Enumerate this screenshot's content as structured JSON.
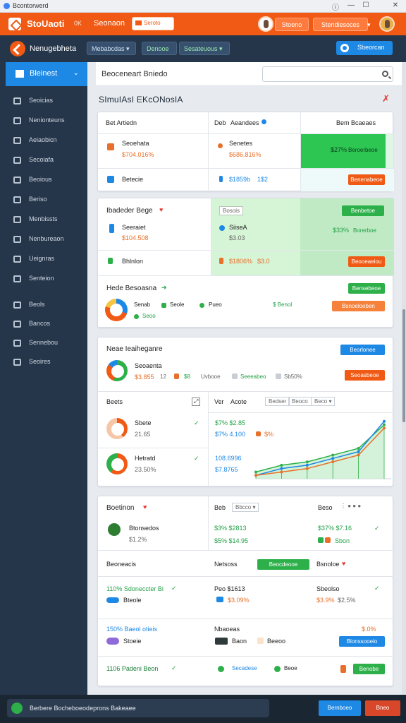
{
  "window": {
    "title": "Bcontorwerd",
    "controls": [
      "ⓘ",
      "—",
      "☐",
      "✕"
    ]
  },
  "topbar": {
    "brand": "StoUaoti",
    "hint": "0K",
    "text": "Seonaon",
    "input": "Seroto",
    "btn1": "Stoeno",
    "btn2": "Stendiesoces"
  },
  "navbar": {
    "title": "Nenugebheta",
    "select1": "Mebabcdas",
    "select2": "Denooe",
    "select3": "Sesateuous",
    "button": "Sbeorcan"
  },
  "sidebar": {
    "active": "Bleinest",
    "items": [
      "Seoicias",
      "Nenionteuns",
      "Aeiaobicn",
      "Secoiafa",
      "Beoious",
      "Beriso",
      "Menbissts",
      "Nenbureaon",
      "Ueignras",
      "Senteion",
      "Beols",
      "Bancos",
      "Sennebou",
      "Seoires"
    ]
  },
  "header": {
    "breadcrumb": "Beoceneart Bniedo",
    "title": "SImuIAsI EKcONosIA"
  },
  "card1": {
    "h1": "Bet Artiedn",
    "h2": "Deb",
    "h3": "Aeandees",
    "h4": "Bem Bcaeaes",
    "r1t": "Seoehata",
    "r1v": "$704.016%",
    "r1m": "Senetes",
    "r1mv": "$686.816%",
    "r1p": "$27%",
    "r1pl": "Beroerbeoe",
    "r2t": "Betecie",
    "r2v": "$1859b",
    "r2v2": "1$2",
    "r2b": "Benenabeoe"
  },
  "card2": {
    "title": "Ibadeder Bege",
    "chip": "Bosois",
    "btn1": "Benbetoe",
    "r1t": "Seeraiet",
    "r1v": "$104.508",
    "r1m": "SiiseA",
    "r1mv": "$3.03",
    "r1p": "$33%",
    "r1pl": "Borerboe",
    "r2t": "Bhlnlon",
    "r2v": "$1806%",
    "r2v2": "$3.0",
    "r2b": "Beooeaeiou",
    "r3t": "Hede Besoasna",
    "r3b": "Bensebeoe",
    "r4a": "Senab",
    "r4b": "Seole",
    "r4c": "Pueo",
    "r4d": "$ Benol",
    "r4e": "Seoo",
    "r4btn": "Bsnoelooben"
  },
  "card3": {
    "title": "Neae Ieaiheganre",
    "btn1": "Beorlonee",
    "sub": "Seoaenta",
    "v1": "$3.855",
    "v2": "12",
    "v3": "$8",
    "v4": "Uvbooe",
    "v5": "Seeeabeo",
    "v6": "Sb50%",
    "btn2": "Seoasbeoe",
    "lh": "Beets",
    "rh1": "Ver",
    "rh2": "Acote",
    "sel1": "Bedser",
    "sel2": "Beoco",
    "sel3": "Beco",
    "r1t": "Sbete",
    "r1v": "21.65",
    "r1a": "$7% $2.85",
    "r1b": "$7% 4.100",
    "r1c": "$%",
    "r2t": "Hetratd",
    "r2v": "23.50%",
    "r2a": "108.6996",
    "r2b": "$7.8765"
  },
  "chart_data": {
    "type": "line",
    "series": [
      {
        "values": [
          2,
          4,
          5,
          7,
          9,
          16
        ]
      },
      {
        "values": [
          1,
          3,
          4,
          6,
          8,
          17
        ]
      },
      {
        "values": [
          1,
          2,
          3,
          5,
          7,
          15
        ]
      }
    ],
    "ylim": [
      0,
      18
    ]
  },
  "card4": {
    "title": "Boetinon",
    "h2": "Beb",
    "sel": "Bbcco",
    "h3": "Beso",
    "r1t": "Btonsedos",
    "r1v": "$1.2%",
    "r1a": "$3% $2813",
    "r1b": "$5% $14.95",
    "r1c": "$37% $7.16",
    "r1d": "Sbon",
    "s2l": "Beoneacis",
    "s2m": "Netsoss",
    "s2btn": "Beocdeooe",
    "s2r": "Bsnoloe",
    "r3t": "110% Sdoneccter Bi",
    "r3s": "Bteole",
    "r3m": "Peo $1613",
    "r3mv": "$3.09%",
    "r3r": "Sbeolso",
    "r3rv": "$3.9%",
    "r3r2": "$2.5%",
    "r4t": "150% Baeol otieis",
    "r4s": "Stoeie",
    "r4m": "Nbaoeas",
    "r4m2": "Baon",
    "r4m3": "Beeoo",
    "r4r": "$.0%",
    "r4btn": "Blonssooelo",
    "r5t": "1106 Padeni Beon",
    "r5m": "Secadese",
    "r5m2": "Beoe",
    "r5btn": "Benobe"
  },
  "footer": {
    "input": "Berbere Bocheboeodeprons Bakeaee",
    "btn1": "Bernboeo",
    "btn2": "Bneo"
  }
}
